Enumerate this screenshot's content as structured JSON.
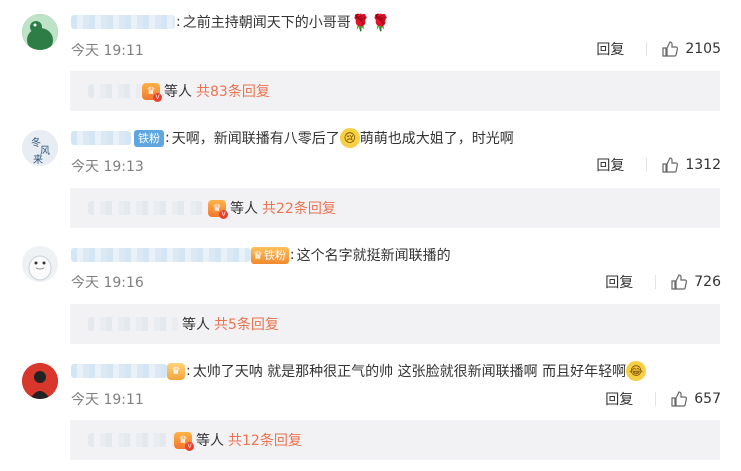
{
  "comments": [
    {
      "text": "之前主持朝闻天下的小哥哥",
      "time": "今天 19:11",
      "reply_label": "回复",
      "likes": "2105",
      "thread_suffix": "等人",
      "thread_link": "共83条回复"
    },
    {
      "fan_badge": "铁粉",
      "text_before": "天啊，新闻联播有八零后了",
      "text_after": "萌萌也成大姐了，时光啊",
      "time": "今天 19:13",
      "reply_label": "回复",
      "likes": "1312",
      "thread_suffix": "等人",
      "thread_link": "共22条回复"
    },
    {
      "fan_badge": "铁粉",
      "text": "这个名字就挺新闻联播的",
      "time": "今天 19:16",
      "reply_label": "回复",
      "likes": "726",
      "thread_suffix": "等人",
      "thread_link": "共5条回复"
    },
    {
      "text": "太帅了天呐 就是那种很正气的帅 这张脸就很新闻联播啊 而且好年轻啊",
      "time": "今天 19:11",
      "reply_label": "回复",
      "likes": "657",
      "thread_suffix": "等人",
      "thread_link": "共12条回复"
    }
  ],
  "colors": {
    "link": "#eb7350",
    "meta": "#808080",
    "sub_bg": "#f2f2f5",
    "badge": "#5fa6df"
  },
  "icons": [
    "rose-emoji",
    "crying-emoji",
    "laughing-emoji",
    "thumbs-up-icon",
    "vip-crown-icon"
  ]
}
